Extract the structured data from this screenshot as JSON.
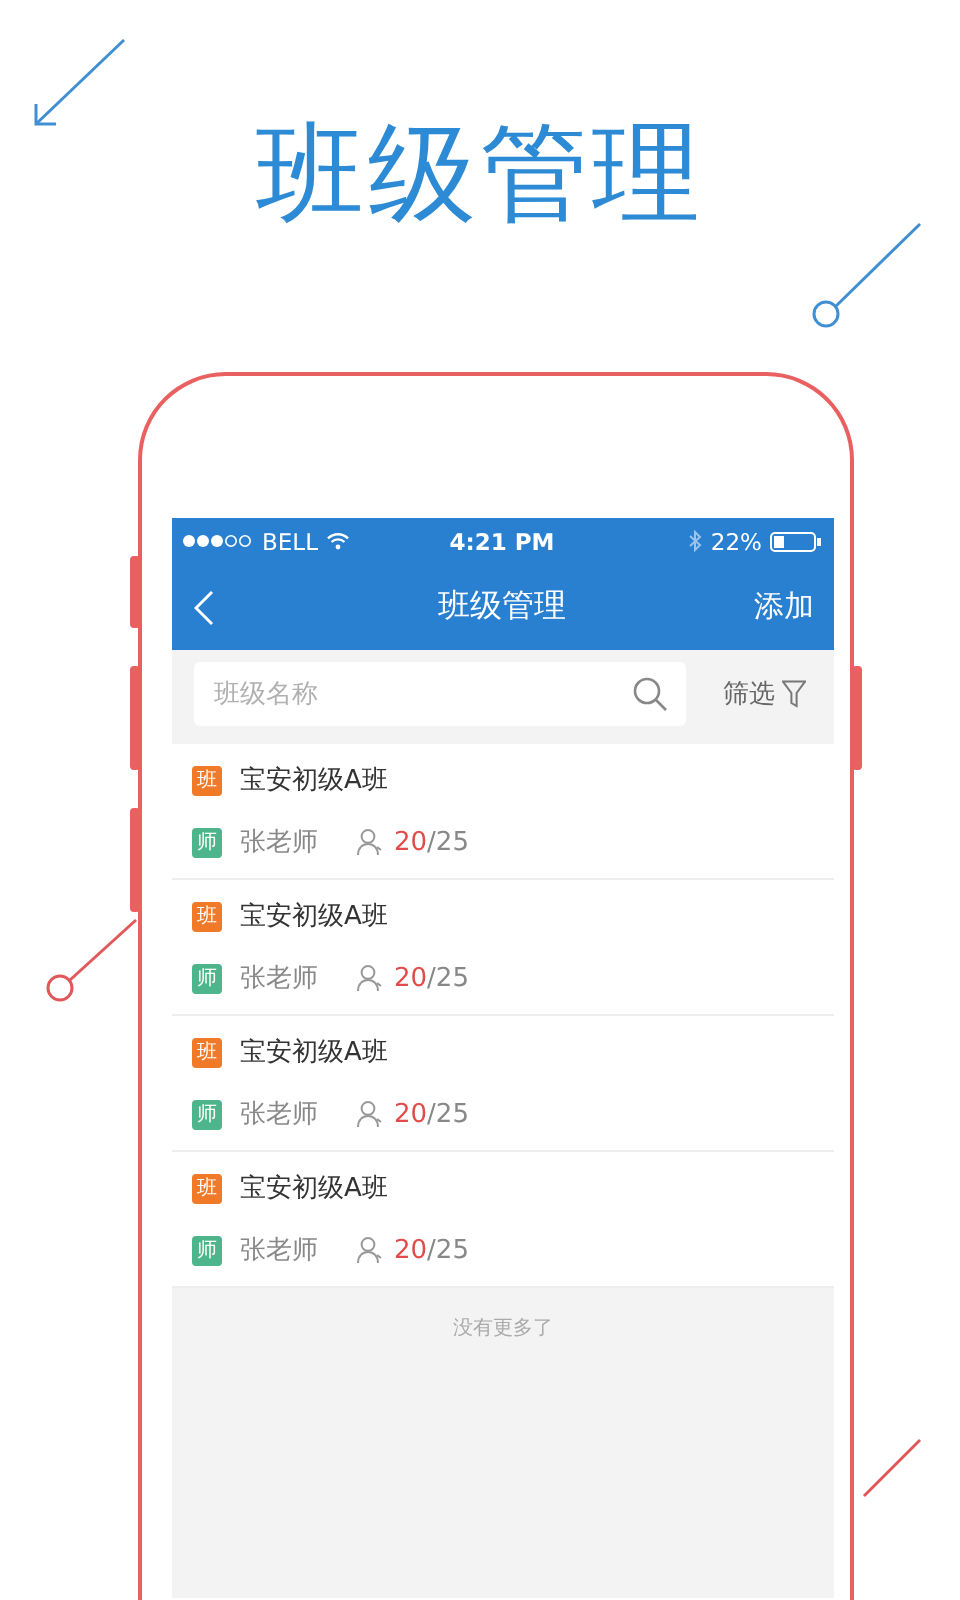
{
  "headline": "班级管理",
  "status_bar": {
    "carrier": "BELL",
    "time": "4:21 PM",
    "battery": "22%"
  },
  "nav": {
    "title": "班级管理",
    "action": "添加"
  },
  "search": {
    "placeholder": "班级名称"
  },
  "filter": {
    "label": "筛选"
  },
  "classes": [
    {
      "badge": "班",
      "name": "宝安初级A班",
      "teacher_badge": "师",
      "teacher": "张老师",
      "count_current": "20",
      "count_total": "/25"
    },
    {
      "badge": "班",
      "name": "宝安初级A班",
      "teacher_badge": "师",
      "teacher": "张老师",
      "count_current": "20",
      "count_total": "/25"
    },
    {
      "badge": "班",
      "name": "宝安初级A班",
      "teacher_badge": "师",
      "teacher": "张老师",
      "count_current": "20",
      "count_total": "/25"
    },
    {
      "badge": "班",
      "name": "宝安初级A班",
      "teacher_badge": "师",
      "teacher": "张老师",
      "count_current": "20",
      "count_total": "/25"
    }
  ],
  "footer": "没有更多了"
}
